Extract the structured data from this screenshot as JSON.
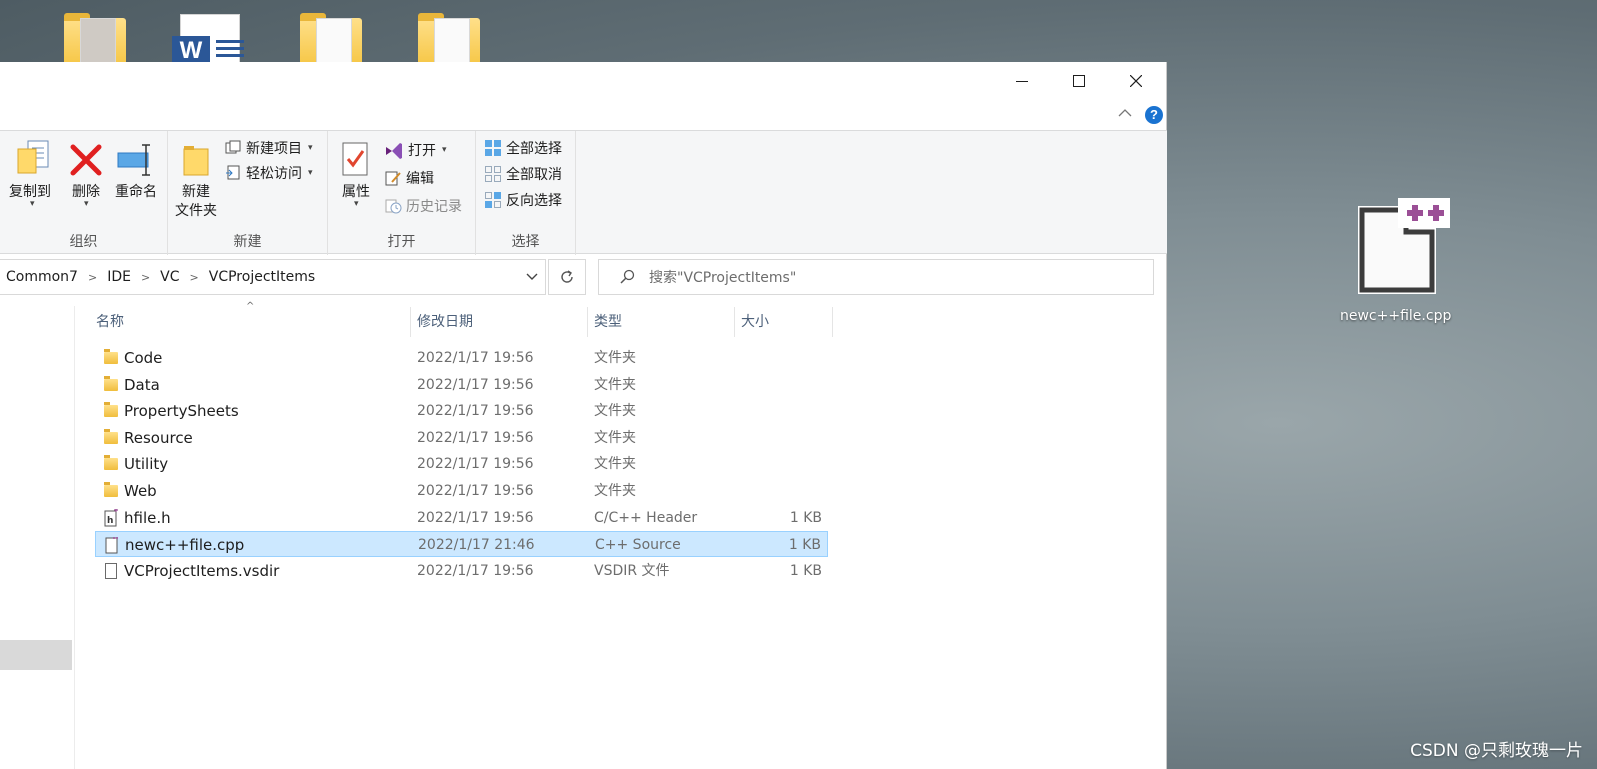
{
  "window": {
    "minimize_label": "—",
    "help_label": "?"
  },
  "ribbon": {
    "organize": {
      "label": "组织",
      "copy_to": "复制到",
      "delete": "删除",
      "rename": "重命名"
    },
    "new": {
      "label": "新建",
      "new_folder_line1": "新建",
      "new_folder_line2": "文件夹",
      "new_item": "新建项目",
      "easy_access": "轻松访问"
    },
    "open": {
      "label": "打开",
      "properties": "属性",
      "open": "打开",
      "edit": "编辑",
      "history": "历史记录"
    },
    "select": {
      "label": "选择",
      "select_all": "全部选择",
      "select_none": "全部取消",
      "invert": "反向选择"
    }
  },
  "address": {
    "crumbs": [
      "Common7",
      "IDE",
      "VC",
      "VCProjectItems"
    ]
  },
  "search": {
    "placeholder": "搜索\"VCProjectItems\""
  },
  "columns": {
    "name": "名称",
    "date": "修改日期",
    "type": "类型",
    "size": "大小"
  },
  "files": [
    {
      "name": "Code",
      "date": "2022/1/17 19:56",
      "type": "文件夹",
      "size": "",
      "icon": "folder-icon"
    },
    {
      "name": "Data",
      "date": "2022/1/17 19:56",
      "type": "文件夹",
      "size": "",
      "icon": "folder-icon"
    },
    {
      "name": "PropertySheets",
      "date": "2022/1/17 19:56",
      "type": "文件夹",
      "size": "",
      "icon": "folder-icon"
    },
    {
      "name": "Resource",
      "date": "2022/1/17 19:56",
      "type": "文件夹",
      "size": "",
      "icon": "folder-icon"
    },
    {
      "name": "Utility",
      "date": "2022/1/17 19:56",
      "type": "文件夹",
      "size": "",
      "icon": "folder-icon"
    },
    {
      "name": "Web",
      "date": "2022/1/17 19:56",
      "type": "文件夹",
      "size": "",
      "icon": "folder-icon"
    },
    {
      "name": "hfile.h",
      "date": "2022/1/17 19:56",
      "type": "C/C++ Header",
      "size": "1 KB",
      "icon": "h-file-icon"
    },
    {
      "name": "newc++file.cpp",
      "date": "2022/1/17 21:46",
      "type": "C++ Source",
      "size": "1 KB",
      "icon": "cpp-file-icon",
      "selected": true
    },
    {
      "name": "VCProjectItems.vsdir",
      "date": "2022/1/17 19:56",
      "type": "VSDIR 文件",
      "size": "1 KB",
      "icon": "file-icon"
    }
  ],
  "desktop": {
    "cpp_icon_label": "newc++file.cpp",
    "word_badge": "W"
  },
  "watermark": "CSDN @只剩玫瑰一片",
  "colors": {
    "selection_bg": "#cce8ff",
    "selection_border": "#99d1ff",
    "accent_blue": "#1a73d1",
    "cpp_purple": "#9b4f96"
  }
}
